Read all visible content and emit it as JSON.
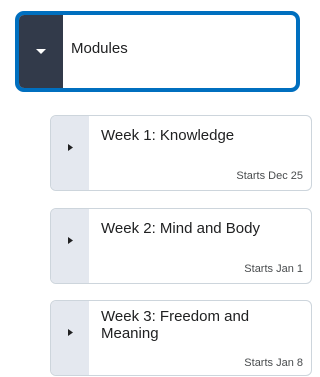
{
  "modules": {
    "title": "Modules",
    "toggle_icon": "caret-down-icon",
    "accent_color": "#006fbf",
    "toggle_bg": "#323a4a"
  },
  "weeks": [
    {
      "title": "Week 1: Knowledge",
      "starts": "Starts Dec 25",
      "icon": "caret-right-icon"
    },
    {
      "title": "Week 2: Mind and Body",
      "starts": "Starts Jan 1",
      "icon": "caret-right-icon"
    },
    {
      "title": "Week 3: Freedom and Meaning",
      "starts": "Starts Jan 8",
      "icon": "caret-right-icon"
    }
  ]
}
